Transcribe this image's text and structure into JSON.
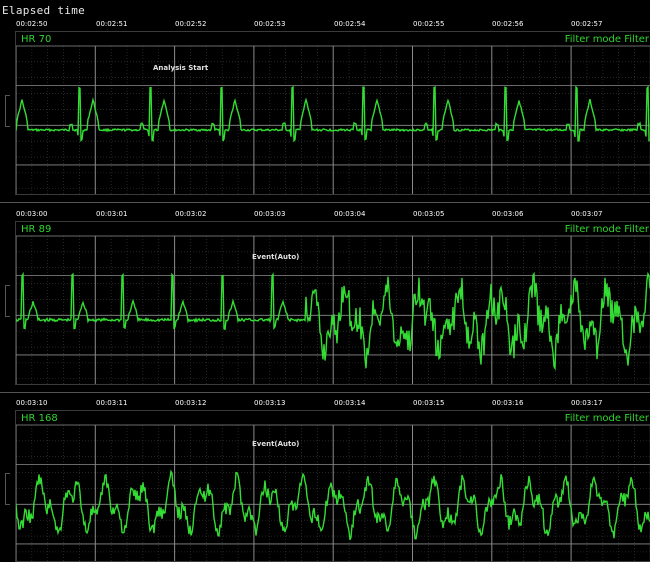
{
  "header": {
    "title": "Elapsed time"
  },
  "strips": [
    {
      "hr_label": "HR 70",
      "filter_label": "Filter mode   Filter",
      "event_label": "Analysis Start",
      "timestamps": [
        "00:02:50",
        "00:02:51",
        "00:02:52",
        "00:02:53",
        "00:02:54",
        "00:02:55",
        "00:02:56",
        "00:02:57"
      ]
    },
    {
      "hr_label": "HR 89",
      "filter_label": "Filter mode   Filter",
      "event_label": "Event(Auto)",
      "timestamps": [
        "00:03:00",
        "00:03:01",
        "00:03:02",
        "00:03:03",
        "00:03:04",
        "00:03:05",
        "00:03:06",
        "00:03:07"
      ]
    },
    {
      "hr_label": "HR 168",
      "filter_label": "Filter mode   Filter",
      "event_label": "Event(Auto)",
      "timestamps": [
        "00:03:10",
        "00:03:11",
        "00:03:12",
        "00:03:13",
        "00:03:14",
        "00:03:15",
        "00:03:16",
        "00:03:17"
      ]
    }
  ],
  "colors": {
    "trace": "#33dd33",
    "grid_major": "#8a8a8a",
    "grid_minor": "#3c3c3c",
    "background": "#000000"
  }
}
